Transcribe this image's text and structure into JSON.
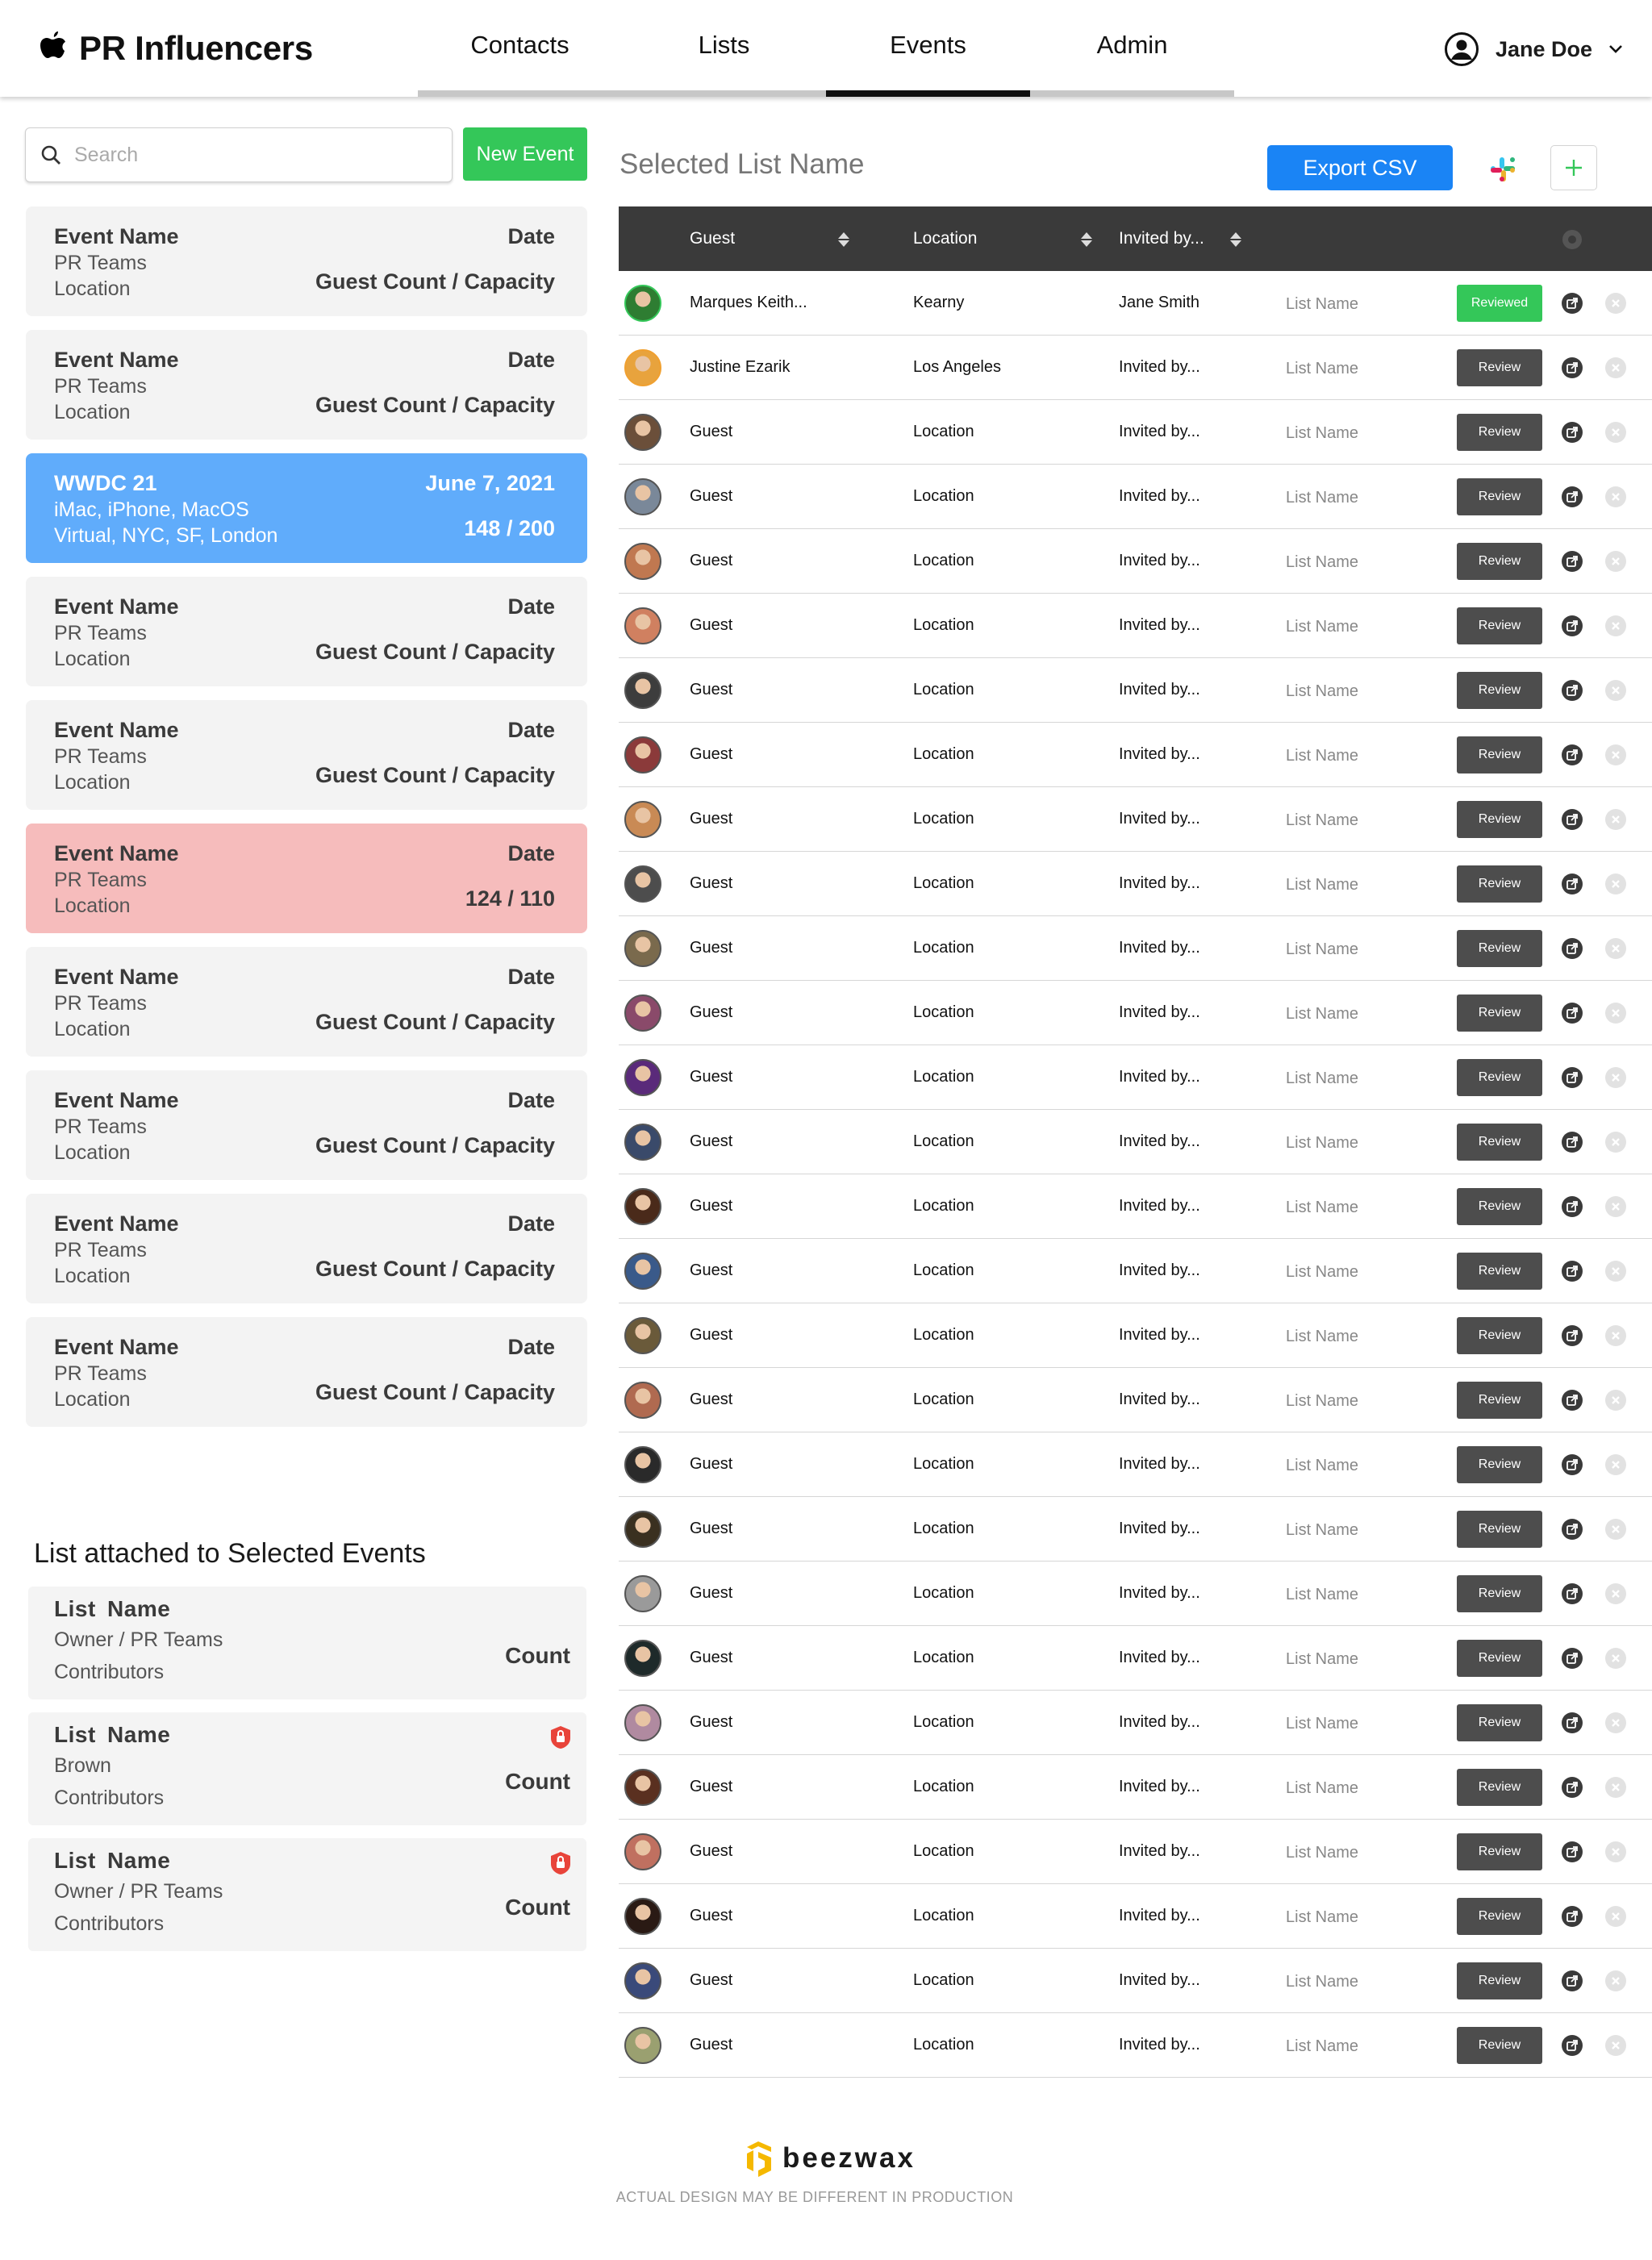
{
  "app": {
    "title": "PR Influencers"
  },
  "nav": {
    "tabs": [
      {
        "label": "Contacts"
      },
      {
        "label": "Lists"
      },
      {
        "label": "Events",
        "active": true
      },
      {
        "label": "Admin"
      }
    ]
  },
  "user": {
    "name": "Jane Doe"
  },
  "sidebar": {
    "search_placeholder": "Search",
    "new_event_label": "New Event",
    "events": [
      {
        "name": "Event Name",
        "team": "PR Teams",
        "location": "Location",
        "date": "Date",
        "count": "Guest Count / Capacity",
        "state": "default"
      },
      {
        "name": "Event Name",
        "team": "PR Teams",
        "location": "Location",
        "date": "Date",
        "count": "Guest Count / Capacity",
        "state": "default"
      },
      {
        "name": "WWDC 21",
        "team": "iMac, iPhone, MacOS",
        "location": "Virtual, NYC, SF, London",
        "date": "June 7, 2021",
        "count": "148 / 200",
        "state": "selected"
      },
      {
        "name": "Event Name",
        "team": "PR Teams",
        "location": "Location",
        "date": "Date",
        "count": "Guest Count / Capacity",
        "state": "default"
      },
      {
        "name": "Event Name",
        "team": "PR Teams",
        "location": "Location",
        "date": "Date",
        "count": "Guest Count / Capacity",
        "state": "default"
      },
      {
        "name": "Event Name",
        "team": "PR Teams",
        "location": "Location",
        "date": "Date",
        "count": "124 / 110",
        "state": "over-capacity"
      },
      {
        "name": "Event Name",
        "team": "PR Teams",
        "location": "Location",
        "date": "Date",
        "count": "Guest Count / Capacity",
        "state": "default"
      },
      {
        "name": "Event Name",
        "team": "PR Teams",
        "location": "Location",
        "date": "Date",
        "count": "Guest Count / Capacity",
        "state": "default"
      },
      {
        "name": "Event Name",
        "team": "PR Teams",
        "location": "Location",
        "date": "Date",
        "count": "Guest Count / Capacity",
        "state": "default"
      },
      {
        "name": "Event Name",
        "team": "PR Teams",
        "location": "Location",
        "date": "Date",
        "count": "Guest Count / Capacity",
        "state": "default"
      }
    ],
    "lists_title": "List attached to Selected Events",
    "lists": [
      {
        "name": "List  Name",
        "owner": "Owner / PR Teams",
        "contributors": "Contributors",
        "count": "Count",
        "locked": false
      },
      {
        "name": "List  Name",
        "owner": "Brown",
        "contributors": "Contributors",
        "count": "Count",
        "locked": true
      },
      {
        "name": "List  Name",
        "owner": "Owner / PR Teams",
        "contributors": "Contributors",
        "count": "Count",
        "locked": true
      }
    ]
  },
  "main": {
    "title": "Selected List Name",
    "export_label": "Export CSV",
    "columns": {
      "guest": "Guest",
      "location": "Location",
      "invited_by": "Invited by..."
    },
    "rows": [
      {
        "guest": "Marques Keith...",
        "location": "Kearny",
        "invited_by": "Jane Smith",
        "list": "List Name",
        "status": "Reviewed"
      },
      {
        "guest": "Justine Ezarik",
        "location": "Los Angeles",
        "invited_by": "Invited by...",
        "list": "List Name",
        "status": "Review"
      },
      {
        "guest": "Guest",
        "location": "Location",
        "invited_by": "Invited by...",
        "list": "List Name",
        "status": "Review"
      },
      {
        "guest": "Guest",
        "location": "Location",
        "invited_by": "Invited by...",
        "list": "List Name",
        "status": "Review"
      },
      {
        "guest": "Guest",
        "location": "Location",
        "invited_by": "Invited by...",
        "list": "List Name",
        "status": "Review"
      },
      {
        "guest": "Guest",
        "location": "Location",
        "invited_by": "Invited by...",
        "list": "List Name",
        "status": "Review"
      },
      {
        "guest": "Guest",
        "location": "Location",
        "invited_by": "Invited by...",
        "list": "List Name",
        "status": "Review"
      },
      {
        "guest": "Guest",
        "location": "Location",
        "invited_by": "Invited by...",
        "list": "List Name",
        "status": "Review"
      },
      {
        "guest": "Guest",
        "location": "Location",
        "invited_by": "Invited by...",
        "list": "List Name",
        "status": "Review"
      },
      {
        "guest": "Guest",
        "location": "Location",
        "invited_by": "Invited by...",
        "list": "List Name",
        "status": "Review"
      },
      {
        "guest": "Guest",
        "location": "Location",
        "invited_by": "Invited by...",
        "list": "List Name",
        "status": "Review"
      },
      {
        "guest": "Guest",
        "location": "Location",
        "invited_by": "Invited by...",
        "list": "List Name",
        "status": "Review"
      },
      {
        "guest": "Guest",
        "location": "Location",
        "invited_by": "Invited by...",
        "list": "List Name",
        "status": "Review"
      },
      {
        "guest": "Guest",
        "location": "Location",
        "invited_by": "Invited by...",
        "list": "List Name",
        "status": "Review"
      },
      {
        "guest": "Guest",
        "location": "Location",
        "invited_by": "Invited by...",
        "list": "List Name",
        "status": "Review"
      },
      {
        "guest": "Guest",
        "location": "Location",
        "invited_by": "Invited by...",
        "list": "List Name",
        "status": "Review"
      },
      {
        "guest": "Guest",
        "location": "Location",
        "invited_by": "Invited by...",
        "list": "List Name",
        "status": "Review"
      },
      {
        "guest": "Guest",
        "location": "Location",
        "invited_by": "Invited by...",
        "list": "List Name",
        "status": "Review"
      },
      {
        "guest": "Guest",
        "location": "Location",
        "invited_by": "Invited by...",
        "list": "List Name",
        "status": "Review"
      },
      {
        "guest": "Guest",
        "location": "Location",
        "invited_by": "Invited by...",
        "list": "List Name",
        "status": "Review"
      },
      {
        "guest": "Guest",
        "location": "Location",
        "invited_by": "Invited by...",
        "list": "List Name",
        "status": "Review"
      },
      {
        "guest": "Guest",
        "location": "Location",
        "invited_by": "Invited by...",
        "list": "List Name",
        "status": "Review"
      },
      {
        "guest": "Guest",
        "location": "Location",
        "invited_by": "Invited by...",
        "list": "List Name",
        "status": "Review"
      },
      {
        "guest": "Guest",
        "location": "Location",
        "invited_by": "Invited by...",
        "list": "List Name",
        "status": "Review"
      },
      {
        "guest": "Guest",
        "location": "Location",
        "invited_by": "Invited by...",
        "list": "List Name",
        "status": "Review"
      },
      {
        "guest": "Guest",
        "location": "Location",
        "invited_by": "Invited by...",
        "list": "List Name",
        "status": "Review"
      },
      {
        "guest": "Guest",
        "location": "Location",
        "invited_by": "Invited by...",
        "list": "List Name",
        "status": "Review"
      },
      {
        "guest": "Guest",
        "location": "Location",
        "invited_by": "Invited by...",
        "list": "List Name",
        "status": "Review"
      }
    ]
  },
  "footer": {
    "logo_text": "beezwax",
    "disclaimer": "ACTUAL DESIGN MAY BE DIFFERENT IN PRODUCTION"
  },
  "colors": {
    "accent_green": "#34c759",
    "export_blue": "#1a84f5",
    "selected_blue": "#60acfb",
    "over_capacity_red": "#f6bcbc",
    "header_dark": "#3a3a3a",
    "lock_red": "#e8443a"
  },
  "icons": [
    "apple-logo-icon",
    "user-circle-icon",
    "chevron-down-icon",
    "search-icon",
    "slack-icon",
    "plus-icon",
    "sort-icon",
    "settings-icon",
    "external-link-icon",
    "remove-icon",
    "lock-icon",
    "beezwax-logo-icon"
  ]
}
